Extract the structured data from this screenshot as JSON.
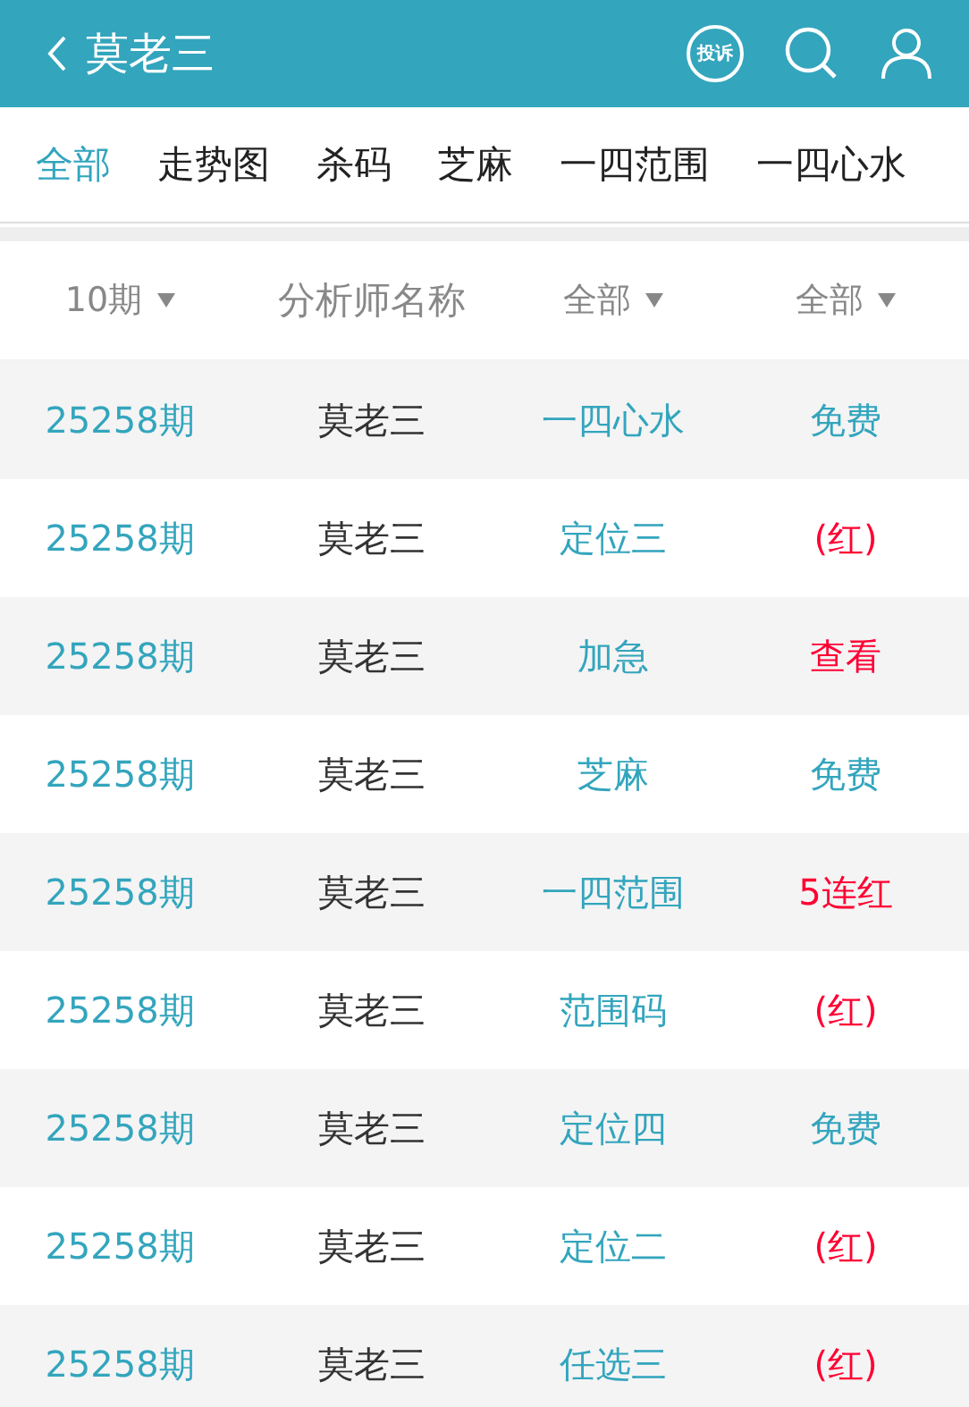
{
  "header": {
    "title": "莫老三",
    "complaint_label": "投诉"
  },
  "tabs": [
    {
      "label": "全部",
      "selected": true
    },
    {
      "label": "走势图",
      "selected": false
    },
    {
      "label": "杀码",
      "selected": false
    },
    {
      "label": "芝麻",
      "selected": false
    },
    {
      "label": "一四范围",
      "selected": false
    },
    {
      "label": "一四心水",
      "selected": false
    }
  ],
  "filters": [
    {
      "label": "10期",
      "kind": "dropdown"
    },
    {
      "label": "分析师名称",
      "kind": "plain"
    },
    {
      "label": "全部",
      "kind": "dropdown"
    },
    {
      "label": "全部",
      "kind": "dropdown"
    }
  ],
  "rows": [
    {
      "period": "25258期",
      "analyst": "莫老三",
      "category": "一四心水",
      "result": "免费",
      "color": "#33a5bd"
    },
    {
      "period": "25258期",
      "analyst": "莫老三",
      "category": "定位三",
      "result": "(红)",
      "color": "#ff0033"
    },
    {
      "period": "25258期",
      "analyst": "莫老三",
      "category": "加急",
      "result": "查看",
      "color": "#ff0033"
    },
    {
      "period": "25258期",
      "analyst": "莫老三",
      "category": "芝麻",
      "result": "免费",
      "color": "#33a5bd"
    },
    {
      "period": "25258期",
      "analyst": "莫老三",
      "category": "一四范围",
      "result": "5连红",
      "color": "#ff0033"
    },
    {
      "period": "25258期",
      "analyst": "莫老三",
      "category": "范围码",
      "result": "(红)",
      "color": "#ff0033"
    },
    {
      "period": "25258期",
      "analyst": "莫老三",
      "category": "定位四",
      "result": "免费",
      "color": "#33a5bd"
    },
    {
      "period": "25258期",
      "analyst": "莫老三",
      "category": "定位二",
      "result": "(红)",
      "color": "#ff0033"
    },
    {
      "period": "25258期",
      "analyst": "莫老三",
      "category": "任选三",
      "result": "(红)",
      "color": "#ff0033"
    }
  ]
}
